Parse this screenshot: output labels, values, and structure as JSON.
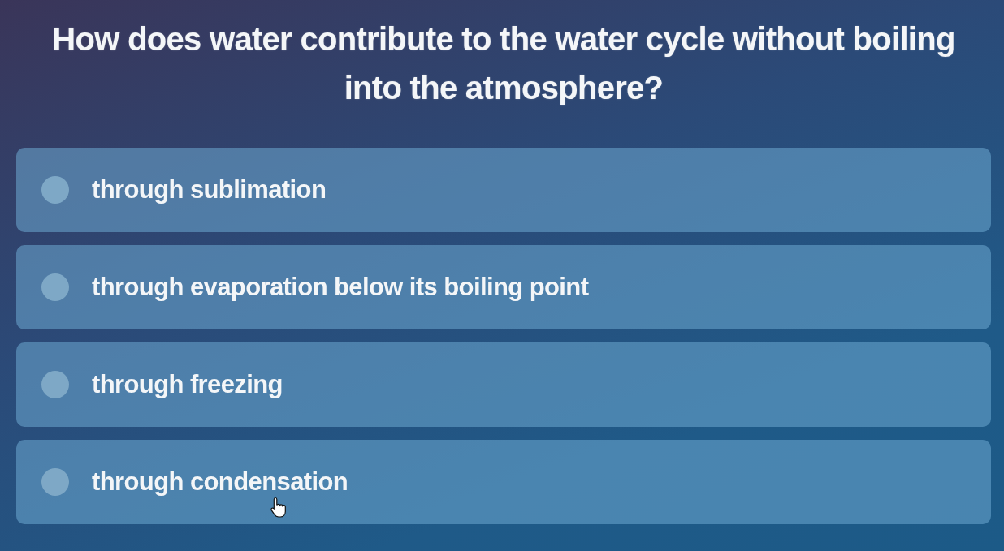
{
  "question": "How does water contribute to the water cycle without boiling into the atmosphere?",
  "options": [
    {
      "label": "through sublimation",
      "selected": false
    },
    {
      "label": "through evaporation below its boiling point",
      "selected": false
    },
    {
      "label": "through freezing",
      "selected": false
    },
    {
      "label": "through condensation",
      "selected": false
    }
  ]
}
